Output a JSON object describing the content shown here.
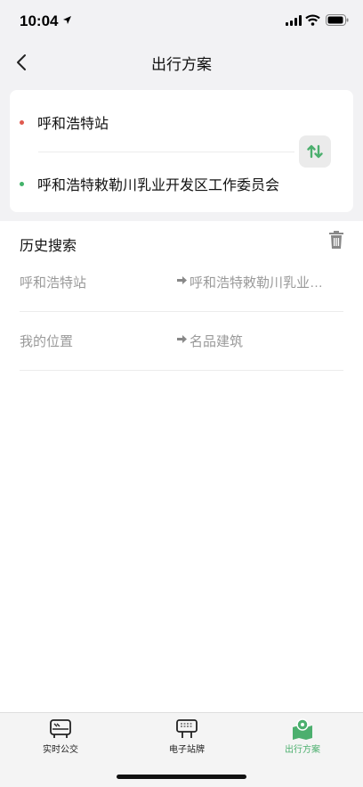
{
  "status_bar": {
    "time": "10:04"
  },
  "nav": {
    "title": "出行方案"
  },
  "route": {
    "start": "呼和浩特站",
    "end": "呼和浩特敕勒川乳业开发区工作委员会",
    "colors": {
      "start_dot": "#e05a4f",
      "end_dot": "#43b36a"
    }
  },
  "history": {
    "title": "历史搜索",
    "items": [
      {
        "from": "呼和浩特站",
        "to": "呼和浩特敕勒川乳业…"
      },
      {
        "from": "我的位置",
        "to": "名品建筑"
      }
    ]
  },
  "tabs": [
    {
      "label": "实时公交",
      "icon": "bus-icon",
      "active": false
    },
    {
      "label": "电子站牌",
      "icon": "stop-sign-icon",
      "active": false
    },
    {
      "label": "出行方案",
      "icon": "map-pin-icon",
      "active": true
    }
  ],
  "accent_color": "#4caf6e"
}
